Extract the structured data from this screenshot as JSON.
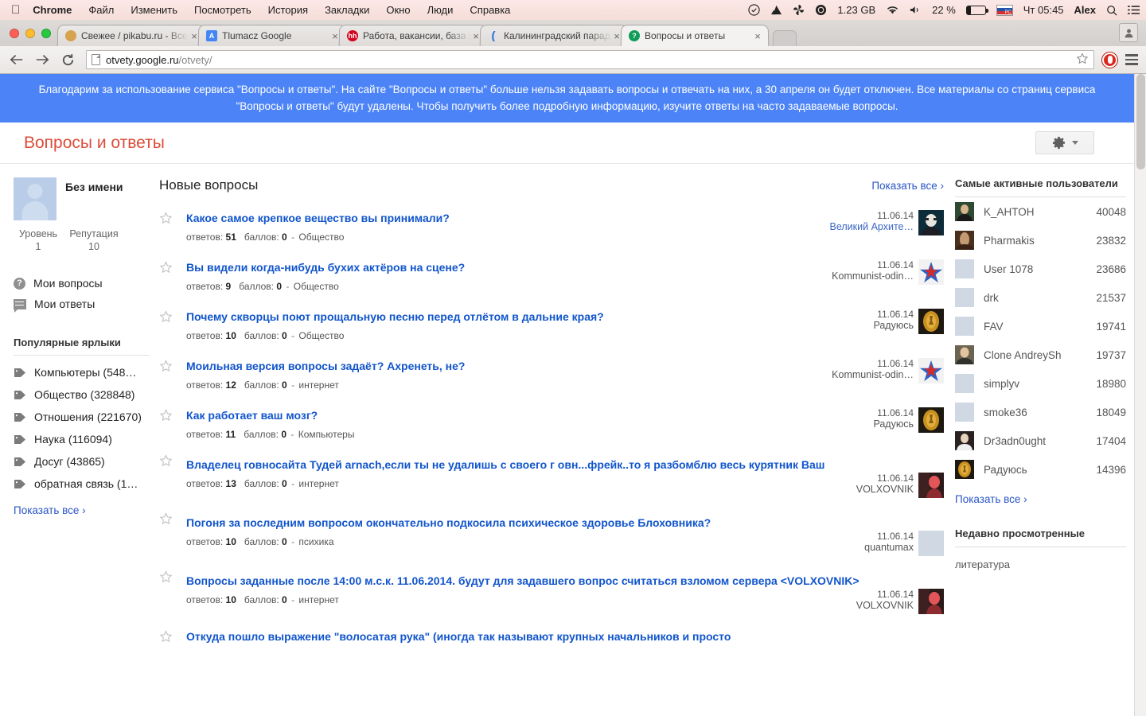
{
  "os_menu": {
    "apple_icon": "apple-icon",
    "items": [
      "Chrome",
      "Файл",
      "Изменить",
      "Посмотреть",
      "История",
      "Закладки",
      "Окно",
      "Люди",
      "Справка"
    ],
    "status": {
      "dropbox_icon": "dropbox-icon",
      "drive_icon": "google-drive-icon",
      "pinwheel_icon": "pinwheel-icon",
      "disk_icon": "disk-icon",
      "disk_free": "1.23 GB",
      "wifi_icon": "wifi-icon",
      "volume_icon": "volume-icon",
      "battery_percent": "22 %",
      "flag_label": "РС",
      "clock": "Чт 05:45",
      "user": "Alex",
      "search_icon": "spotlight-search-icon",
      "list_icon": "notification-center-icon"
    }
  },
  "browser": {
    "tabs": [
      {
        "title": "Свежее / pikabu.ru - Все",
        "favicon": "pikabu-icon",
        "active": false
      },
      {
        "title": "Tlumacz Google",
        "favicon": "google-translate-icon",
        "active": false
      },
      {
        "title": "Работа, вакансии, база р...",
        "favicon": "hh-icon",
        "active": false
      },
      {
        "title": "Калининградский парадо...",
        "favicon": "crescent-icon",
        "active": false
      },
      {
        "title": "Вопросы и ответы",
        "favicon": "question-icon",
        "active": true
      }
    ],
    "close_label": "×",
    "new_tab_label": "+",
    "back_icon": "back-arrow-icon",
    "forward_icon": "forward-arrow-icon",
    "reload_icon": "reload-icon",
    "url_host": "otvety.google.ru",
    "url_path": "/otvety/",
    "bookmark_icon": "bookmark-star-icon",
    "extension_icon": "opera-extension-icon",
    "menu_icon": "chrome-menu-icon",
    "profile_icon": "profile-icon"
  },
  "banner": {
    "text": "Благодарим за использование сервиса \"Вопросы и ответы\". На сайте \"Вопросы и ответы\" больше нельзя задавать вопросы и отвечать на них, а 30 апреля он будет отключен. Все материалы со страниц сервиса \"Вопросы и ответы\" будут удалены. Чтобы получить более подробную информацию, изучите ответы на часто задаваемые вопросы.",
    "background": "#4c84f7"
  },
  "page_header": {
    "title": "Вопросы и ответы",
    "title_color": "#dd4b39",
    "settings_icon": "gear-icon",
    "settings_caret": "chevron-down-icon"
  },
  "sidebar": {
    "profile": {
      "avatar": "default-avatar",
      "name": "Без имени",
      "level_label": "Уровень",
      "level_value": "1",
      "reputation_label": "Репутация",
      "reputation_value": "10"
    },
    "nav": [
      {
        "label": "Мои вопросы",
        "icon": "question-circle-icon"
      },
      {
        "label": "Мои ответы",
        "icon": "comment-icon"
      }
    ],
    "labels_heading": "Популярные ярлыки",
    "labels": [
      {
        "label": "Компьютеры (548…",
        "icon": "tag-icon"
      },
      {
        "label": "Общество (328848)",
        "icon": "tag-icon"
      },
      {
        "label": "Отношения (221670)",
        "icon": "tag-icon"
      },
      {
        "label": "Наука (116094)",
        "icon": "tag-icon"
      },
      {
        "label": "Досуг (43865)",
        "icon": "tag-icon"
      },
      {
        "label": "обратная связь (1…",
        "icon": "tag-icon"
      }
    ],
    "show_all": "Показать все ›"
  },
  "main": {
    "heading": "Новые вопросы",
    "show_all": "Показать все ›",
    "meta_answers_label": "ответов:",
    "meta_points_label": "баллов:",
    "questions": [
      {
        "title": "Какое самое крепкое вещество вы принимали?",
        "answers": "51",
        "points": "0",
        "tag": "Общество",
        "date": "11.06.14",
        "author": "Великий Архите…",
        "author_link": true,
        "avatar": "avatar-vampire"
      },
      {
        "title": "Вы видели когда-нибудь бухих актёров на сцене?",
        "answers": "9",
        "points": "0",
        "tag": "Общество",
        "date": "11.06.14",
        "author": "Kommunist-odin…",
        "author_link": false,
        "avatar": "avatar-red-star"
      },
      {
        "title": "Почему скворцы поют прощальную песню перед отлётом в дальние края?",
        "answers": "10",
        "points": "0",
        "tag": "Общество",
        "date": "11.06.14",
        "author": "Радуюсь",
        "author_link": false,
        "avatar": "avatar-gold-medal"
      },
      {
        "title": "Моильная версия вопросы задаёт? Ахренеть, не?",
        "answers": "12",
        "points": "0",
        "tag": "интернет",
        "date": "11.06.14",
        "author": "Kommunist-odin…",
        "author_link": false,
        "avatar": "avatar-red-star"
      },
      {
        "title": "Как работает ваш мозг?",
        "answers": "11",
        "points": "0",
        "tag": "Компьютеры",
        "date": "11.06.14",
        "author": "Радуюсь",
        "author_link": false,
        "avatar": "avatar-gold-medal"
      },
      {
        "title": "Владелец говносайта Тудей arnach,если ты не удалишь с своего г овн...фрейк..то я разбомблю весь курятник Ваш",
        "answers": "13",
        "points": "0",
        "tag": "интернет",
        "date": "11.06.14",
        "author": "VOLXOVNIK",
        "author_link": false,
        "avatar": "avatar-photo-red"
      },
      {
        "title": "Погоня за последним вопросом окончательно подкосила психическое здоровье Блоховника?",
        "answers": "10",
        "points": "0",
        "tag": "психика",
        "date": "11.06.14",
        "author": "quantumax",
        "author_link": false,
        "avatar": "default-avatar"
      },
      {
        "title": "Вопросы заданные после 14:00 м.с.к. 11.06.2014. будут для задавшего вопрос считаться взломом сервера <VOLXOVNIK>",
        "answers": "10",
        "points": "0",
        "tag": "интернет",
        "date": "11.06.14",
        "author": "VOLXOVNIK",
        "author_link": false,
        "avatar": "avatar-photo-red"
      },
      {
        "title": "Откуда пошло выражение \"волосатая рука\" (иногда так называют крупных начальников и просто",
        "answers": "",
        "points": "",
        "tag": "",
        "date": "",
        "author": "",
        "author_link": false,
        "avatar": ""
      }
    ],
    "star_icon": "star-outline-icon"
  },
  "right": {
    "active_heading": "Самые активные пользователи",
    "users": [
      {
        "name": "K_AHTOH",
        "points": "40048",
        "avatar": "avatar-photo-green"
      },
      {
        "name": "Pharmakis",
        "points": "23832",
        "avatar": "avatar-photo-brown"
      },
      {
        "name": "User 1078",
        "points": "23686",
        "avatar": "default-avatar-blue"
      },
      {
        "name": "drk",
        "points": "21537",
        "avatar": "default-avatar-pale"
      },
      {
        "name": "FAV",
        "points": "19741",
        "avatar": "default-avatar-grey"
      },
      {
        "name": "Clone AndreySh",
        "points": "19737",
        "avatar": "avatar-photo-man"
      },
      {
        "name": "simplyv",
        "points": "18980",
        "avatar": "default-avatar-blue"
      },
      {
        "name": "smoke36",
        "points": "18049",
        "avatar": "default-avatar-pale"
      },
      {
        "name": "Dr3adn0ught",
        "points": "17404",
        "avatar": "avatar-photo-dark"
      },
      {
        "name": "Радуюсь",
        "points": "14396",
        "avatar": "avatar-gold-medal"
      }
    ],
    "show_all": "Показать все ›",
    "recent_heading": "Недавно просмотренные",
    "recent_items": [
      "литература"
    ]
  }
}
